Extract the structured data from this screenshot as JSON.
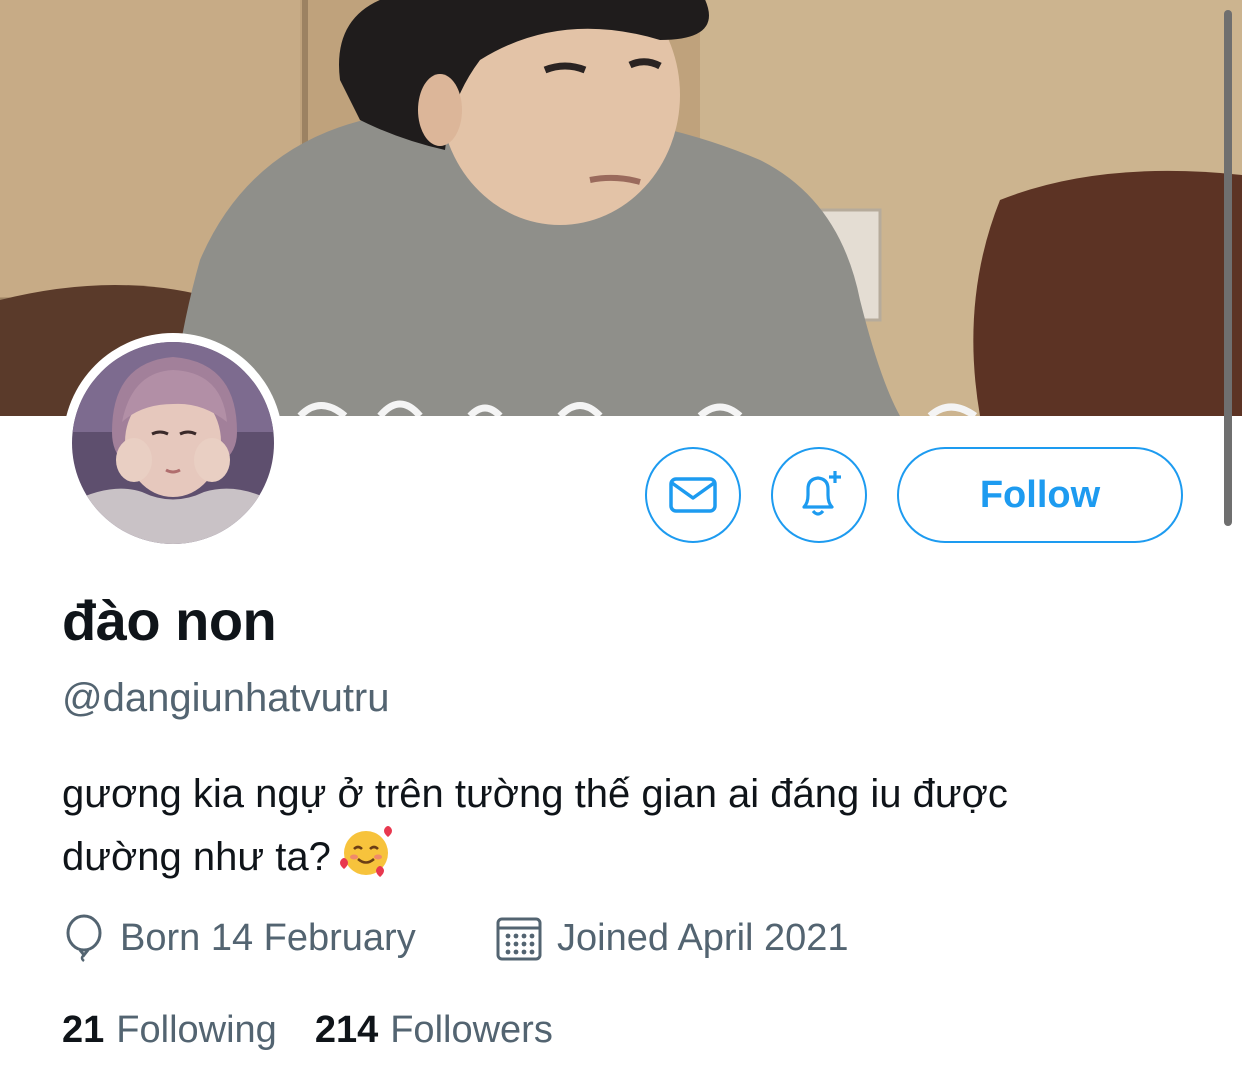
{
  "profile": {
    "display_name": "đào non",
    "handle": "@dangiunhatvutru",
    "bio_line1": "gương kia ngự ở trên tường thế gian ai đáng iu được",
    "bio_line2": "dường như ta?",
    "bio_emoji": "smiling-face-with-hearts-icon",
    "born": "Born 14 February",
    "joined": "Joined April 2021"
  },
  "stats": {
    "following_count": "21",
    "following_label": "Following",
    "followers_count": "214",
    "followers_label": "Followers"
  },
  "actions": {
    "follow_label": "Follow",
    "message_icon": "envelope-icon",
    "notify_icon": "bell-plus-icon"
  },
  "colors": {
    "accent": "#1d9bf0",
    "secondary_text": "#536471",
    "primary_text": "#0f1419"
  }
}
